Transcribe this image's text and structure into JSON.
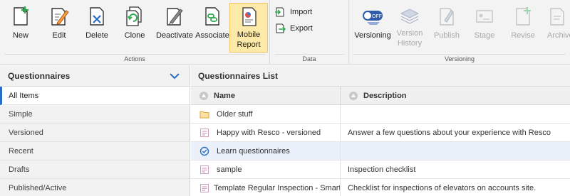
{
  "ribbon": {
    "actions": {
      "label": "Actions",
      "buttons": [
        {
          "label": "New",
          "icon": "new-icon"
        },
        {
          "label": "Edit",
          "icon": "edit-icon"
        },
        {
          "label": "Delete",
          "icon": "delete-icon"
        },
        {
          "label": "Clone",
          "icon": "clone-icon"
        },
        {
          "label": "Deactivate",
          "icon": "deactivate-icon"
        },
        {
          "label": "Associate",
          "icon": "associate-icon"
        },
        {
          "label": "Mobile Report",
          "line1": "Mobile",
          "line2": "Report",
          "icon": "mobile-report-icon"
        }
      ]
    },
    "data": {
      "label": "Data",
      "import_label": "Import",
      "export_label": "Export"
    },
    "versioning": {
      "label": "Versioning",
      "buttons": [
        {
          "label": "Versioning",
          "toggle_text": "OFF"
        },
        {
          "line1": "Version",
          "line2": "History"
        },
        {
          "label": "Publish"
        },
        {
          "label": "Stage"
        },
        {
          "label": "Revise"
        },
        {
          "label": "Archive"
        }
      ]
    }
  },
  "sidebar": {
    "title": "Questionnaires",
    "items": [
      {
        "label": "All Items",
        "selected": true
      },
      {
        "label": "Simple"
      },
      {
        "label": "Versioned"
      },
      {
        "label": "Recent"
      },
      {
        "label": "Drafts"
      },
      {
        "label": "Published/Active"
      }
    ]
  },
  "list": {
    "title": "Questionnaires List",
    "columns": [
      "Name",
      "Description"
    ],
    "rows": [
      {
        "name": "Older stuff",
        "description": "",
        "icon": "folder-icon"
      },
      {
        "name": "Happy with Resco - versioned",
        "description": "Answer a few questions about your experience with Resco",
        "icon": "form-icon"
      },
      {
        "name": "Learn questionnaires",
        "description": "",
        "icon": "check-circle-icon"
      },
      {
        "name": "sample",
        "description": "Inspection checklist",
        "icon": "form-icon"
      },
      {
        "name": "Template Regular Inspection - Smart",
        "description": "Checklist for inspections of elevators on accounts site.",
        "icon": "form-icon"
      }
    ]
  },
  "colors": {
    "accent": "#2b6cc4",
    "active_button_bg": "#fde9a8",
    "folder": "#f5b846",
    "form_icon_pink": "#d9a3c7"
  }
}
